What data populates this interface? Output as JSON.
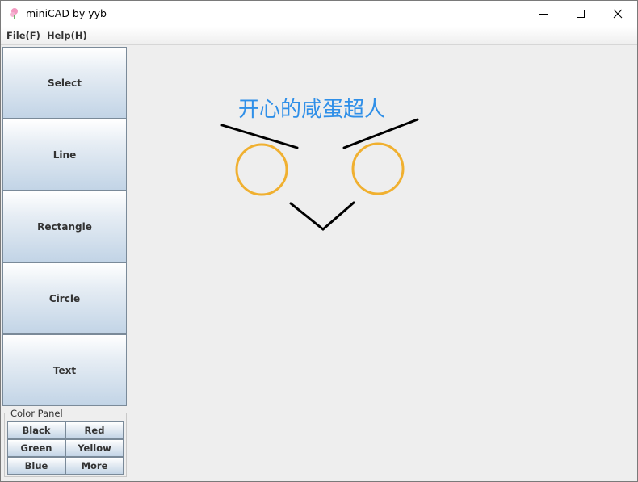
{
  "window": {
    "title": "miniCAD by yyb"
  },
  "menubar": {
    "file": {
      "mnemonic": "F",
      "rest_before": "",
      "rest_after": "ile(F)"
    },
    "help": {
      "mnemonic": "H",
      "rest_before": "",
      "rest_after": "elp(H)"
    }
  },
  "toolbar": {
    "tools": [
      {
        "label": "Select"
      },
      {
        "label": "Line"
      },
      {
        "label": "Rectangle"
      },
      {
        "label": "Circle"
      },
      {
        "label": "Text"
      }
    ]
  },
  "color_panel": {
    "title": "Color Panel",
    "colors": [
      {
        "label": "Black"
      },
      {
        "label": "Red"
      },
      {
        "label": "Green"
      },
      {
        "label": "Yellow"
      },
      {
        "label": "Blue"
      },
      {
        "label": "More"
      }
    ]
  },
  "canvas": {
    "text_shape": {
      "text": "开心的咸蛋超人",
      "color": "#2f8fe8"
    },
    "line_color": "#000000",
    "circle_color": "#f0b030"
  },
  "icons": {
    "app": "app-icon",
    "minimize": "minimize-icon",
    "maximize": "maximize-icon",
    "close": "close-icon"
  }
}
